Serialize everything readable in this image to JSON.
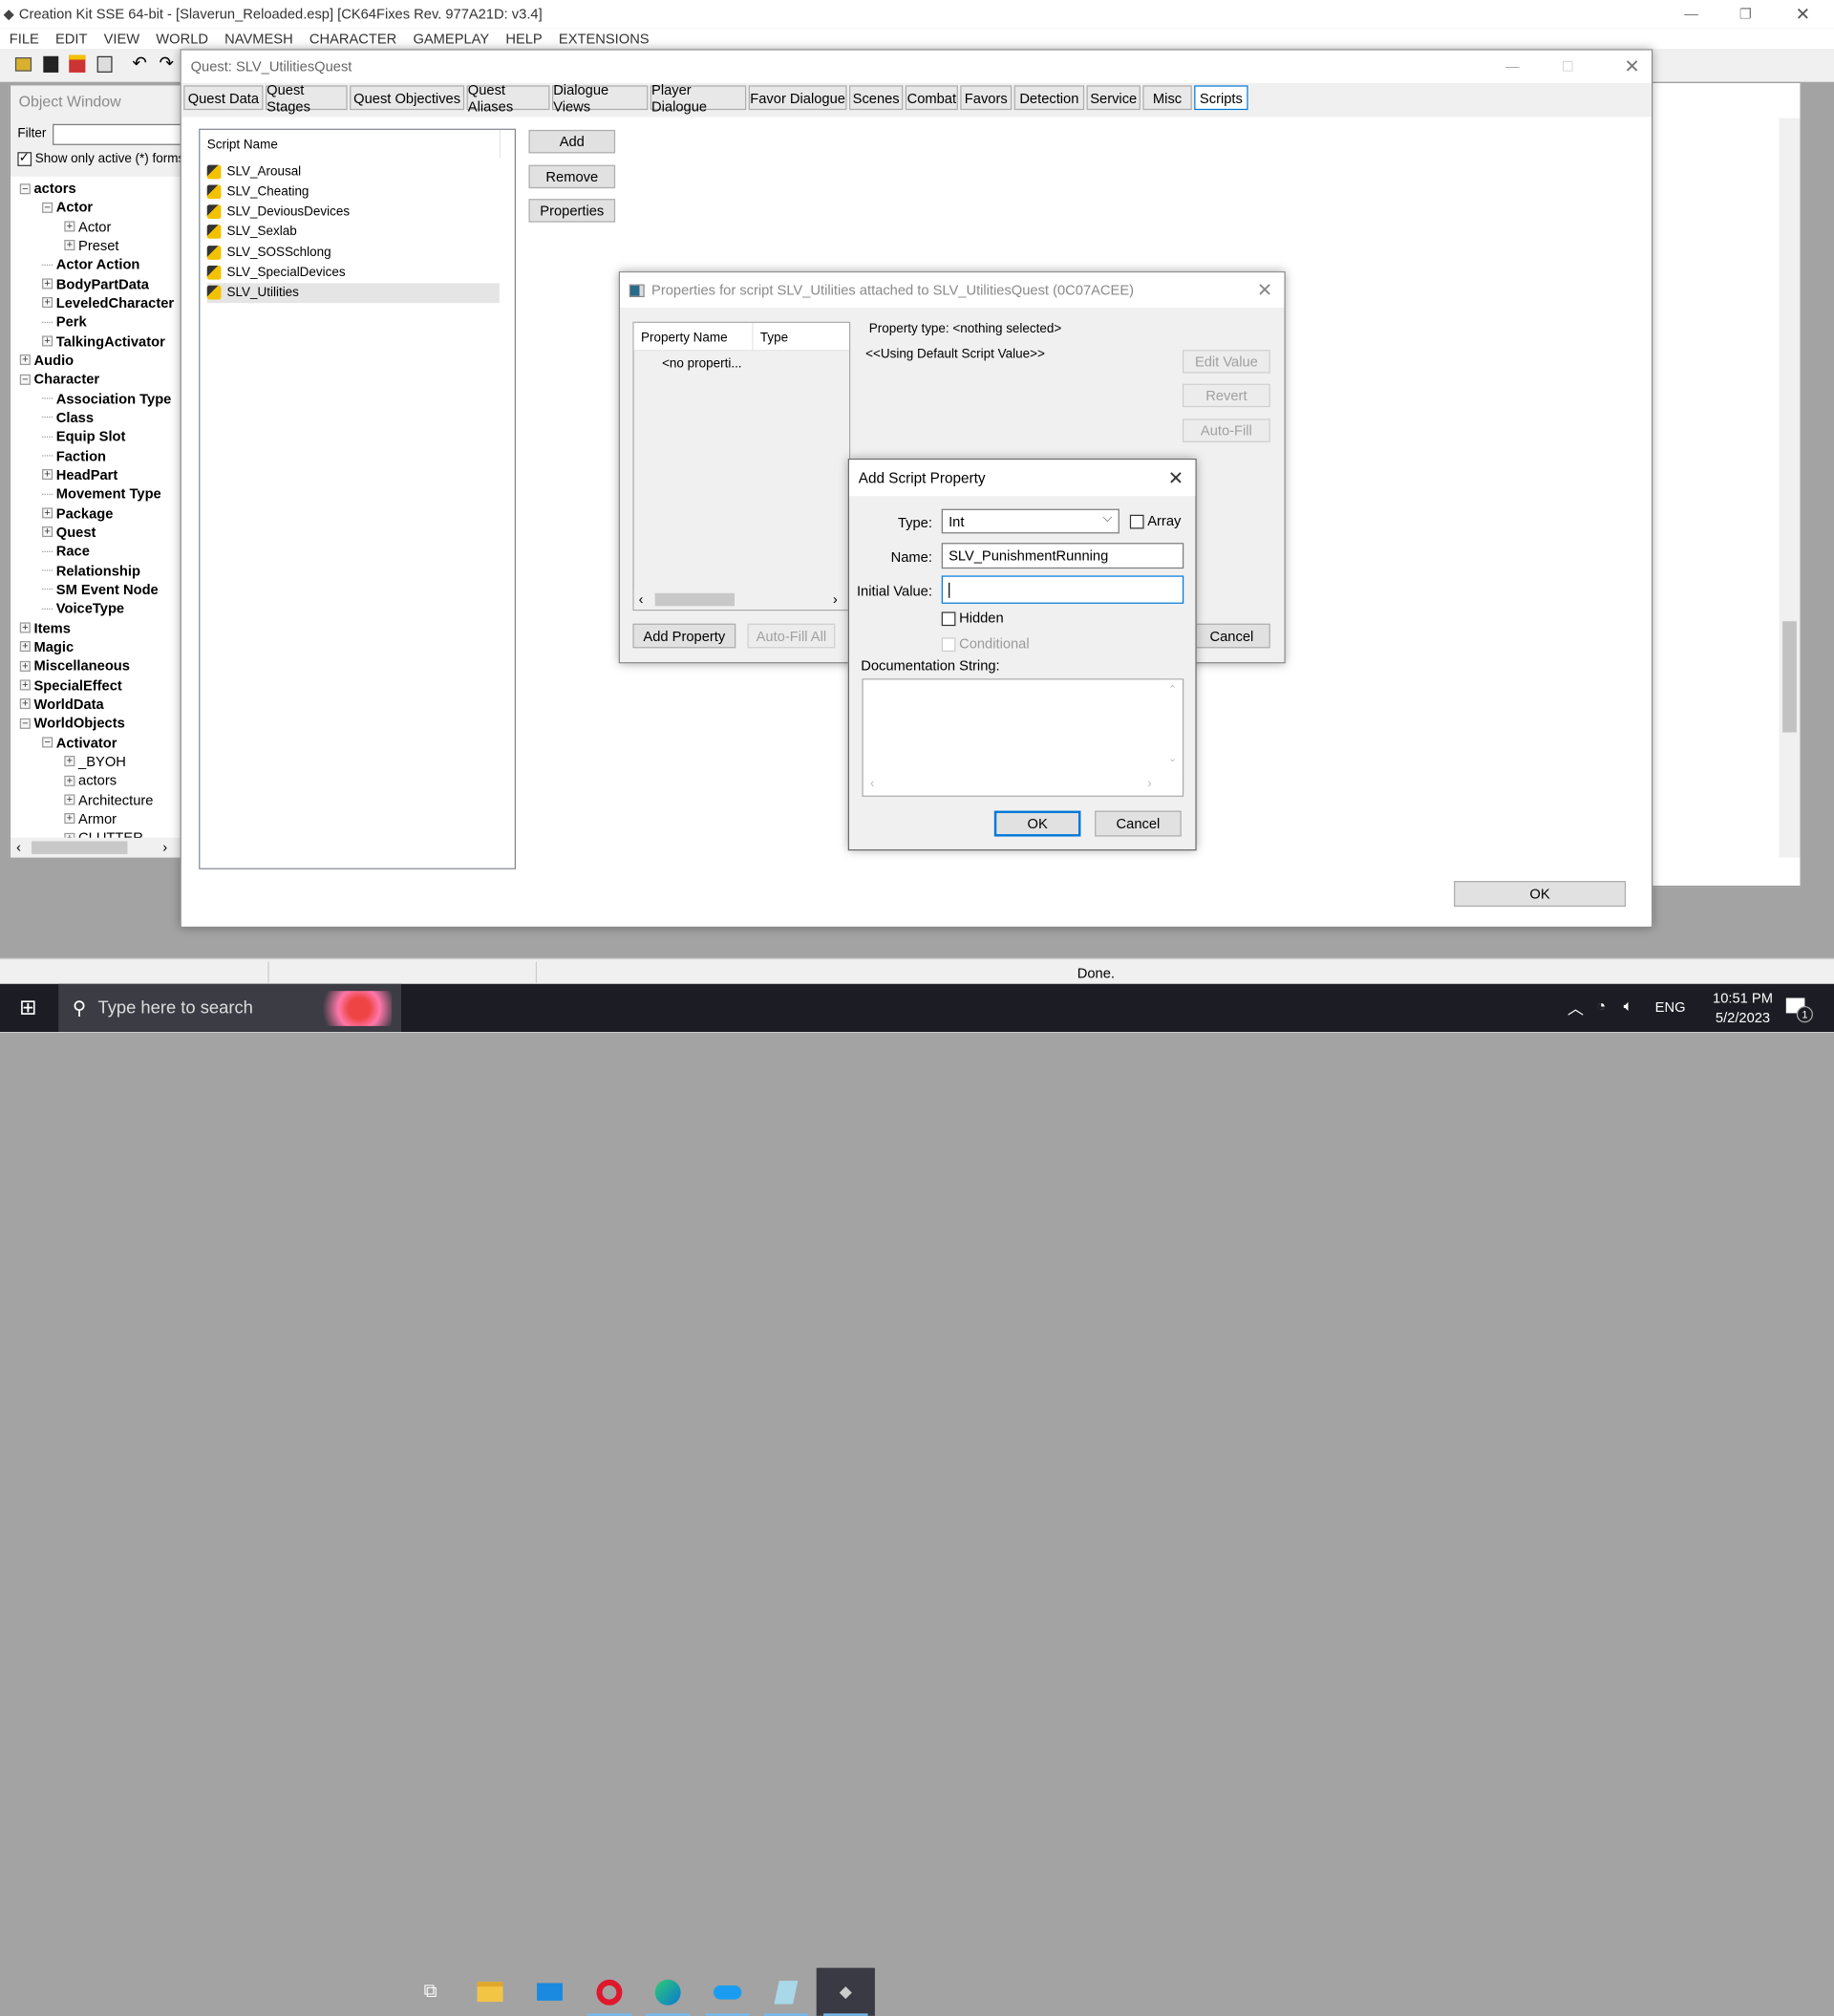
{
  "app": {
    "title": "Creation Kit SSE 64-bit - [Slaverun_Reloaded.esp] [CK64Fixes Rev. 977A21D: v3.4]",
    "menu": [
      "FILE",
      "EDIT",
      "VIEW",
      "WORLD",
      "NAVMESH",
      "CHARACTER",
      "GAMEPLAY",
      "HELP",
      "EXTENSIONS"
    ]
  },
  "object_window": {
    "title": "Object Window",
    "filter_label": "Filter",
    "filter_value": "",
    "show_active_label": "Show only active (*) forms",
    "show_active_checked": true,
    "tree": [
      {
        "label": "actors",
        "level": 0,
        "exp": "-"
      },
      {
        "label": "Actor",
        "level": 1,
        "exp": "-"
      },
      {
        "label": "Actor",
        "level": 2,
        "exp": "+",
        "leaf": true
      },
      {
        "label": "Preset",
        "level": 2,
        "exp": "+",
        "leaf": true
      },
      {
        "label": "Actor Action",
        "level": 1,
        "exp": ""
      },
      {
        "label": "BodyPartData",
        "level": 1,
        "exp": "+"
      },
      {
        "label": "LeveledCharacter",
        "level": 1,
        "exp": "+"
      },
      {
        "label": "Perk",
        "level": 1,
        "exp": ""
      },
      {
        "label": "TalkingActivator",
        "level": 1,
        "exp": "+"
      },
      {
        "label": "Audio",
        "level": 0,
        "exp": "+"
      },
      {
        "label": "Character",
        "level": 0,
        "exp": "-"
      },
      {
        "label": "Association Type",
        "level": 1,
        "exp": ""
      },
      {
        "label": "Class",
        "level": 1,
        "exp": ""
      },
      {
        "label": "Equip Slot",
        "level": 1,
        "exp": ""
      },
      {
        "label": "Faction",
        "level": 1,
        "exp": ""
      },
      {
        "label": "HeadPart",
        "level": 1,
        "exp": "+"
      },
      {
        "label": "Movement Type",
        "level": 1,
        "exp": ""
      },
      {
        "label": "Package",
        "level": 1,
        "exp": "+"
      },
      {
        "label": "Quest",
        "level": 1,
        "exp": "+"
      },
      {
        "label": "Race",
        "level": 1,
        "exp": ""
      },
      {
        "label": "Relationship",
        "level": 1,
        "exp": ""
      },
      {
        "label": "SM Event Node",
        "level": 1,
        "exp": ""
      },
      {
        "label": "VoiceType",
        "level": 1,
        "exp": ""
      },
      {
        "label": "Items",
        "level": 0,
        "exp": "+"
      },
      {
        "label": "Magic",
        "level": 0,
        "exp": "+"
      },
      {
        "label": "Miscellaneous",
        "level": 0,
        "exp": "+"
      },
      {
        "label": "SpecialEffect",
        "level": 0,
        "exp": "+"
      },
      {
        "label": "WorldData",
        "level": 0,
        "exp": "+"
      },
      {
        "label": "WorldObjects",
        "level": 0,
        "exp": "-"
      },
      {
        "label": "Activator",
        "level": 1,
        "exp": "-"
      },
      {
        "label": "_BYOH",
        "level": 2,
        "exp": "+",
        "leaf": true
      },
      {
        "label": "actors",
        "level": 2,
        "exp": "+",
        "leaf": true
      },
      {
        "label": "Architecture",
        "level": 2,
        "exp": "+",
        "leaf": true
      },
      {
        "label": "Armor",
        "level": 2,
        "exp": "+",
        "leaf": true
      },
      {
        "label": "CLUTTER",
        "level": 2,
        "exp": "+",
        "leaf": true
      }
    ]
  },
  "quest_window": {
    "title": "Quest: SLV_UtilitiesQuest",
    "tabs": [
      "Quest Data",
      "Quest Stages",
      "Quest Objectives",
      "Quest Aliases",
      "Dialogue Views",
      "Player Dialogue",
      "Favor Dialogue",
      "Scenes",
      "Combat",
      "Favors",
      "Detection",
      "Service",
      "Misc",
      "Scripts"
    ],
    "active_tab": "Scripts",
    "script_header": "Script Name",
    "scripts": [
      "SLV_Arousal",
      "SLV_Cheating",
      "SLV_DeviousDevices",
      "SLV_Sexlab",
      "SLV_SOSSchlong",
      "SLV_SpecialDevices",
      "SLV_Utilities"
    ],
    "selected_script": "SLV_Utilities",
    "add_label": "Add",
    "remove_label": "Remove",
    "properties_label": "Properties",
    "ok_label": "OK"
  },
  "properties_dialog": {
    "title": "Properties for script SLV_Utilities attached to SLV_UtilitiesQuest (0C07ACEE)",
    "columns": [
      "Property Name",
      "Type"
    ],
    "empty_row": "<no properti...",
    "property_type": "Property type: <nothing selected>",
    "default_value": "<<Using Default Script Value>>",
    "edit_value": "Edit Value",
    "revert": "Revert",
    "auto_fill": "Auto-Fill",
    "add_property": "Add Property",
    "auto_fill_all": "Auto-Fill All",
    "cancel": "Cancel"
  },
  "add_property_dialog": {
    "title": "Add Script Property",
    "type_label": "Type:",
    "type_value": "Int",
    "array_label": "Array",
    "array_checked": false,
    "name_label": "Name:",
    "name_value": "SLV_PunishmentRunning",
    "initial_label": "Initial Value:",
    "initial_value": "",
    "hidden_label": "Hidden",
    "hidden_checked": false,
    "conditional_label": "Conditional",
    "conditional_checked": false,
    "doc_label": "Documentation String:",
    "doc_value": "",
    "ok": "OK",
    "cancel": "Cancel"
  },
  "status": {
    "text": "Done."
  },
  "taskbar": {
    "search_placeholder": "Type here to search",
    "lang": "ENG",
    "time": "10:51 PM",
    "date": "5/2/2023",
    "notifications": "1"
  },
  "colors": {
    "accent": "#0078d7",
    "taskbar": "#1c1c24",
    "desktop_bg": "#a3a3a3"
  }
}
